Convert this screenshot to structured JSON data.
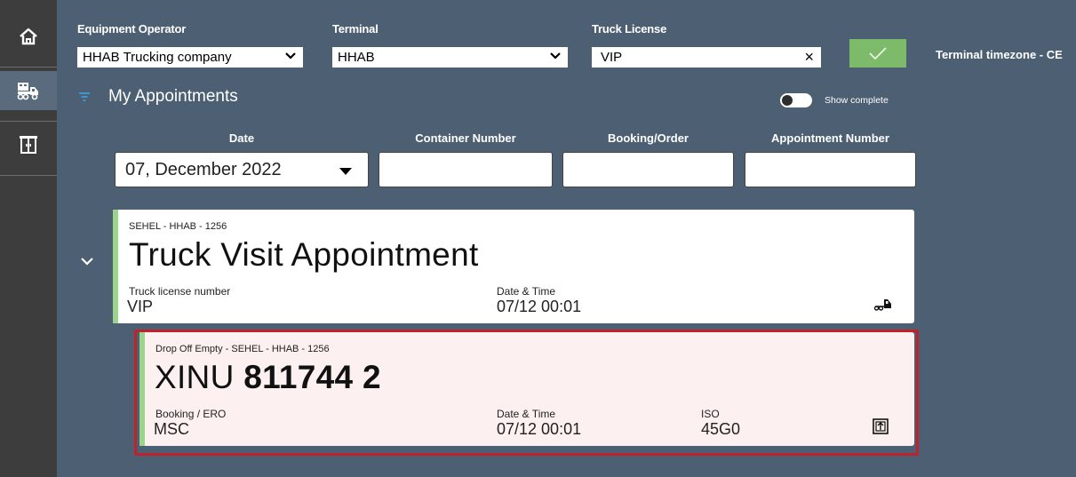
{
  "sidebar": {
    "items": [
      {
        "icon": "home-icon"
      },
      {
        "icon": "truck-appointments-icon"
      },
      {
        "icon": "gate-icon"
      }
    ]
  },
  "header": {
    "operator_label": "Equipment Operator",
    "operator_value": "HHAB Trucking company",
    "terminal_label": "Terminal",
    "terminal_value": "HHAB",
    "license_label": "Truck License",
    "license_value": "VIP",
    "timezone_text": "Terminal timezone - CE"
  },
  "appointments": {
    "title": "My Appointments",
    "show_complete_label": "Show complete",
    "show_complete_on": false
  },
  "filters": {
    "date_label": "Date",
    "date_value": "07, December 2022",
    "container_label": "Container Number",
    "container_value": "",
    "booking_label": "Booking/Order",
    "booking_value": "",
    "appointment_label": "Appointment Number",
    "appointment_value": ""
  },
  "truck_visit": {
    "ref": "SEHEL - HHAB - 1256",
    "title": "Truck Visit Appointment",
    "license_label": "Truck license number",
    "license_value": "VIP",
    "datetime_label": "Date & Time",
    "datetime_value": "07/12 00:01",
    "icon": "truck-icon"
  },
  "transaction": {
    "ref": "Drop Off Empty - SEHEL - HHAB - 1256",
    "container_prefix": "XINU",
    "container_number": "811744 2",
    "booking_label": "Booking / ERO",
    "booking_value": "MSC",
    "datetime_label": "Date & Time",
    "datetime_value": "07/12 00:01",
    "iso_label": "ISO",
    "iso_value": "45G0",
    "icon": "container-drop-icon"
  },
  "colors": {
    "background": "#4d5f73",
    "sidebar": "#3d3d3d",
    "confirm": "#7dba6a",
    "accent_bar": "#9ad58b",
    "highlight": "#c1212b"
  }
}
